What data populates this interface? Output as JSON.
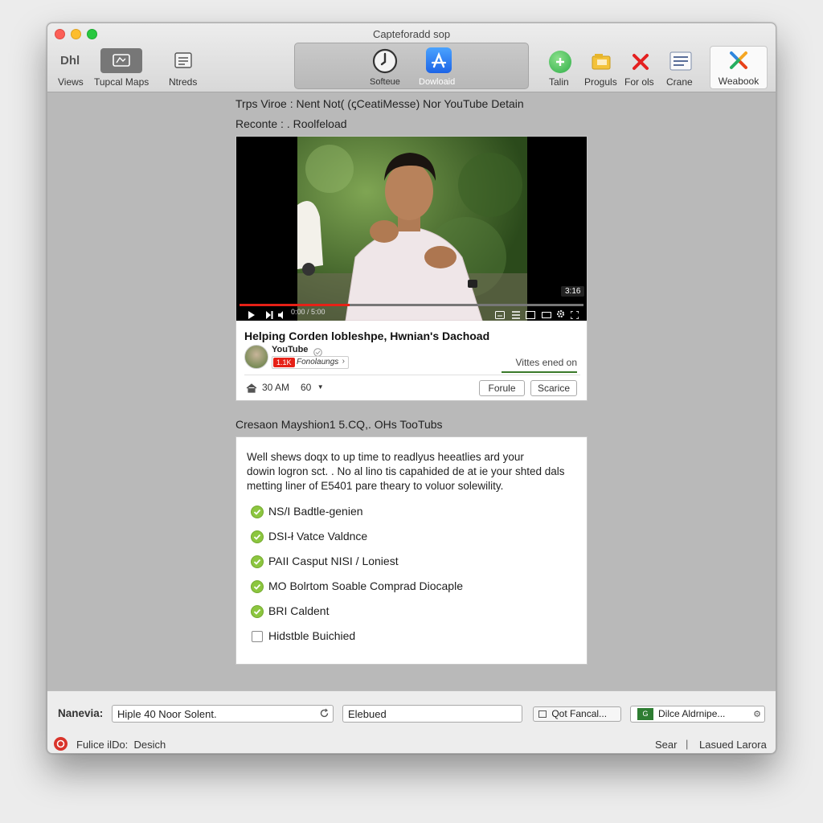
{
  "window": {
    "title": "Capteforadd sop"
  },
  "toolbar": {
    "dhl": "Dhl",
    "views": "Views",
    "typical_maps": "Tupcal Maps",
    "ntreds": "Ntreds",
    "software": "Softeue",
    "download": "Dowloaid",
    "talin": "Talin",
    "proguis": "Proguls",
    "forals": "For ols",
    "crane": "Crane",
    "weabook": "Weabook"
  },
  "content": {
    "heading": "Trps Viroe : Nent Not( (ꞔCeatiMesse) Nor YouTube Detain",
    "subheading": "Reconte : . Roolfeload"
  },
  "video_card": {
    "time_label": "0:00 / 5:00",
    "duration_badge": "3:16",
    "title": "Helping Corden lobleshpe, Hwnian's Dachoad",
    "channel": "YouTube",
    "subscribe_badge": "1.1K",
    "subscribe_text": "Fonolaungs",
    "views_text": "Vittes ened on",
    "time": "30 AM",
    "count": "60",
    "btn_follow": "Forule",
    "btn_search": "Scarice"
  },
  "section": {
    "title": "Cresaon Mayshion1 5.CQ,. OHs TooTubs"
  },
  "description": {
    "line1": "Well shews doqx to up  time to readlyus heeatlies ard your",
    "line2": "dowin logron sct. .  No al lino tis capahided de at ie your shted dals",
    "line3": "metting liner of E5401 pare theary to voluor solewility."
  },
  "checklist": [
    {
      "label": "NS/I Badtle-genien",
      "checked": true
    },
    {
      "label": "DSI-ł Vatce Valdnce",
      "checked": true
    },
    {
      "label": "PAII Casput NISI / Loniest",
      "checked": true
    },
    {
      "label": "MO Bolrtom Soable Comprad Diocaple",
      "checked": true
    },
    {
      "label": "BRI Caldent",
      "checked": true
    },
    {
      "label": "Hidstble Buichied",
      "checked": false
    }
  ],
  "bottom": {
    "nav_label": "Nanevia:",
    "field1": "Hiple 40 Noor Solent.",
    "field2": "Elebued",
    "btn_fancal": "Qot Fancal...",
    "field3": "Dilce Aldrnipe...",
    "status_text": "Fulice ilDo:  Desich",
    "search": "Sear",
    "separator": "|",
    "lasued": "Lasued Larora"
  },
  "colors": {
    "accent_blue": "#2f7ef0",
    "progress_red": "#e62117",
    "check_green": "#8cc63f"
  }
}
